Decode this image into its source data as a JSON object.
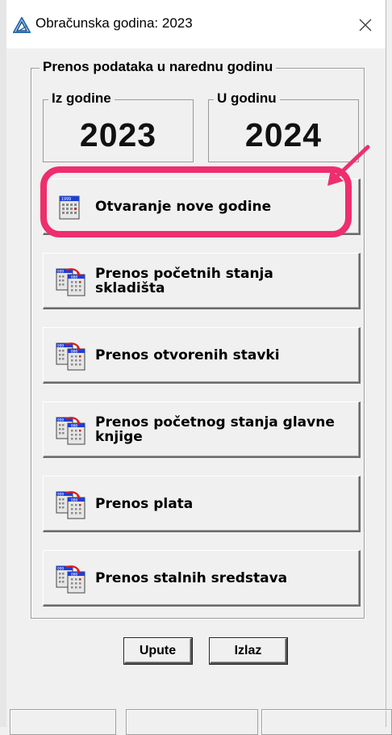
{
  "window": {
    "title": "Obračunska godina: 2023",
    "app_icon": "triangle-logo-icon",
    "close_icon": "close-icon"
  },
  "transfer_group": {
    "legend": "Prenos podataka u narednu godinu",
    "from_year": {
      "label": "Iz godine",
      "value": "2023"
    },
    "to_year": {
      "label": "U godinu",
      "value": "2024"
    }
  },
  "actions": [
    {
      "label": "Otvaranje nove godine",
      "icon": "calendar-icon",
      "highlighted": true
    },
    {
      "label": "Prenos početnih stanja skladišta",
      "icon": "transfer-calendar-icon"
    },
    {
      "label": "Prenos otvorenih stavki",
      "icon": "transfer-calendar-icon"
    },
    {
      "label": "Prenos početnog stanja glavne knjige",
      "icon": "transfer-calendar-icon"
    },
    {
      "label": "Prenos plata",
      "icon": "transfer-calendar-icon"
    },
    {
      "label": "Prenos stalnih sredstava",
      "icon": "transfer-calendar-icon"
    }
  ],
  "footer": {
    "help_label": "Upute",
    "exit_label": "Izlaz"
  },
  "colors": {
    "highlight": "#ee2e6d",
    "window_bg": "#f0f0f0"
  }
}
